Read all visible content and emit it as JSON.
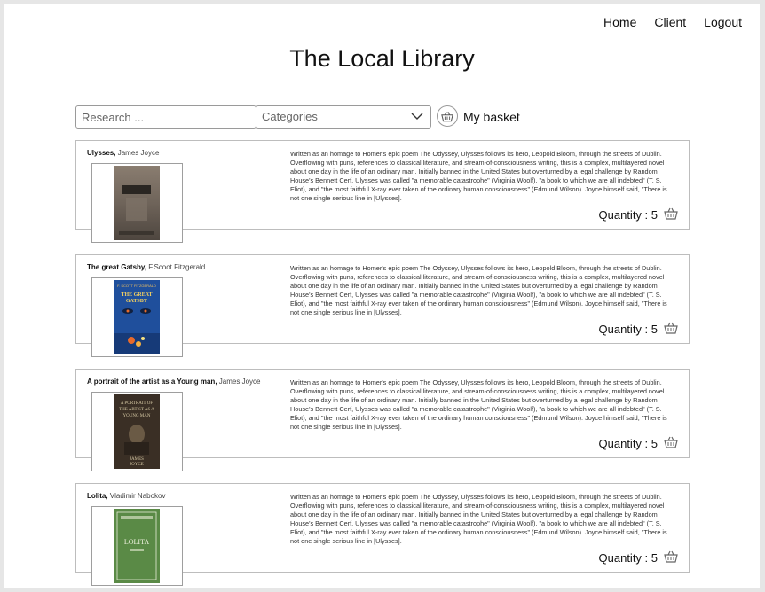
{
  "nav": {
    "home": "Home",
    "client": "Client",
    "logout": "Logout"
  },
  "page_title": "The Local Library",
  "toolbar": {
    "search_placeholder": "Research ...",
    "categories_label": "Categories",
    "basket_label": "My basket",
    "basket_icon": "basket-icon",
    "categories_icon": "chevron-down-icon"
  },
  "books": [
    {
      "title": "Ulysses,",
      "author": "James Joyce",
      "description": "Written as an homage to Homer's epic poem The Odyssey, Ulysses follows its hero, Leopold Bloom, through the streets of Dublin. Overflowing with puns, references to classical literature, and stream-of-consciousness writing, this is a complex, multilayered novel about one day in the life of an ordinary man. Initially banned in the United States but overturned by a legal challenge by Random House's Bennett Cerf, Ulysses was called \"a memorable catastrophe\" (Virginia Woolf), \"a book to which we are all indebted\" (T. S. Eliot), and \"the most faithful X-ray ever taken of the ordinary human consciousness\" (Edmund Wilson). Joyce himself said, \"There is not one single serious line in [Ulysses].",
      "quantity": "Quantity : 5"
    },
    {
      "title": "The great Gatsby,",
      "author": "F.Scoot Fitzgerald",
      "description": "Written as an homage to Homer's epic poem The Odyssey, Ulysses follows its hero, Leopold Bloom, through the streets of Dublin. Overflowing with puns, references to classical literature, and stream-of-consciousness writing, this is a complex, multilayered novel about one day in the life of an ordinary man. Initially banned in the United States but overturned by a legal challenge by Random House's Bennett Cerf, Ulysses was called \"a memorable catastrophe\" (Virginia Woolf), \"a book to which we are all indebted\" (T. S. Eliot), and \"the most faithful X-ray ever taken of the ordinary human consciousness\" (Edmund Wilson). Joyce himself said, \"There is not one single serious line in [Ulysses].",
      "quantity": "Quantity : 5"
    },
    {
      "title": "A portrait of the artist as a Young man,",
      "author": "James Joyce",
      "description": "Written as an homage to Homer's epic poem The Odyssey, Ulysses follows its hero, Leopold Bloom, through the streets of Dublin. Overflowing with puns, references to classical literature, and stream-of-consciousness writing, this is a complex, multilayered novel about one day in the life of an ordinary man. Initially banned in the United States but overturned by a legal challenge by Random House's Bennett Cerf, Ulysses was called \"a memorable catastrophe\" (Virginia Woolf), \"a book to which we are all indebted\" (T. S. Eliot), and \"the most faithful X-ray ever taken of the ordinary human consciousness\" (Edmund Wilson). Joyce himself said, \"There is not one single serious line in [Ulysses].",
      "quantity": "Quantity : 5"
    },
    {
      "title": "Lolita,",
      "author": "Vladimir Nabokov",
      "description": "Written as an homage to Homer's epic poem The Odyssey, Ulysses follows its hero, Leopold Bloom, through the streets of Dublin. Overflowing with puns, references to classical literature, and stream-of-consciousness writing, this is a complex, multilayered novel about one day in the life of an ordinary man. Initially banned in the United States but overturned by a legal challenge by Random House's Bennett Cerf, Ulysses was called \"a memorable catastrophe\" (Virginia Woolf), \"a book to which we are all indebted\" (T. S. Eliot), and \"the most faithful X-ray ever taken of the ordinary human consciousness\" (Edmund Wilson). Joyce himself said, \"There is not one single serious line in [Ulysses].",
      "quantity": "Quantity : 5"
    }
  ],
  "covers": [
    {
      "name": "ulysses-cover",
      "bg": "#6b5f55",
      "accent": "#2a2622",
      "text": ""
    },
    {
      "name": "gatsby-cover",
      "bg": "#1f5fae",
      "accent": "#e86a2a",
      "text": "THE GREAT GATSBY",
      "top_text": "F. SCOTT FITZGERALD"
    },
    {
      "name": "portrait-cover",
      "bg": "#3a2f25",
      "accent": "#cfc29c",
      "text": "A PORTRAIT OF THE ARTIST AS A YOUNG MAN",
      "bottom_text": "JAMES JOYCE"
    },
    {
      "name": "lolita-cover",
      "bg": "#5f8f4a",
      "accent": "#e8ecd6",
      "text": "LOLITA"
    }
  ]
}
